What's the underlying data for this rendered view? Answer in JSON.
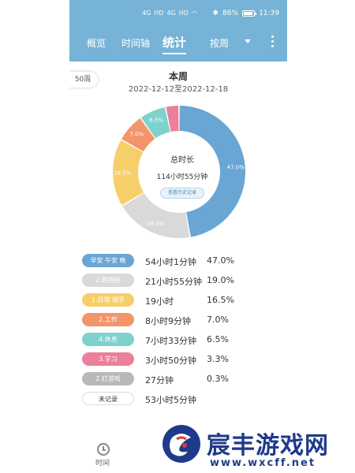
{
  "status_bar": {
    "left_glyphs": [
      "4G",
      "HD",
      "4G",
      "HD"
    ],
    "battery": "86%",
    "time": "11:39"
  },
  "nav": {
    "tabs": [
      {
        "label": "概览",
        "active": false
      },
      {
        "label": "时间轴",
        "active": false
      },
      {
        "label": "统计",
        "active": true
      }
    ],
    "period_select": "按周",
    "icons": [
      "chevron-down-icon",
      "more-vertical-icon"
    ],
    "bar_color": "#77b3d6"
  },
  "week": {
    "chip": "50周",
    "title": "本周",
    "range": "2022-12-12至2022-12-18"
  },
  "summary": {
    "total_label": "总时长",
    "total_value": "114小时55分钟",
    "history_button": "查看历史记录"
  },
  "chart_data": {
    "type": "pie",
    "variant": "donut",
    "slices": [
      {
        "label": "早安 午安 晚",
        "percent": 47.0,
        "color": "#6aa6d4"
      },
      {
        "label": "2.刷视频",
        "percent": 19.0,
        "color": "#d9d9d9"
      },
      {
        "label": "1.日常 顺手",
        "percent": 16.5,
        "color": "#f7cf6a"
      },
      {
        "label": "2.工作",
        "percent": 7.0,
        "color": "#f2956a"
      },
      {
        "label": "4.休息",
        "percent": 6.5,
        "color": "#7fd1cc"
      },
      {
        "label": "3.学习",
        "percent": 3.3,
        "color": "#ec7f9a"
      }
    ],
    "slice_labels": [
      "47.0%",
      "19.0%",
      "16.5%",
      "7.0%",
      "6.5%"
    ]
  },
  "legend": [
    {
      "label": "早安 午安 晚",
      "duration": "54小时1分钟",
      "percent": "47.0%",
      "color": "#6aa6d4"
    },
    {
      "label": "2.刷视频",
      "duration": "21小时55分钟",
      "percent": "19.0%",
      "color": "#d9d9d9"
    },
    {
      "label": "1.日常 顺手",
      "duration": "19小时",
      "percent": "16.5%",
      "color": "#f7cf6a"
    },
    {
      "label": "2.工作",
      "duration": "8小时9分钟",
      "percent": "7.0%",
      "color": "#f2956a"
    },
    {
      "label": "4.休息",
      "duration": "7小时33分钟",
      "percent": "6.5%",
      "color": "#7fd1cc"
    },
    {
      "label": "3.学习",
      "duration": "3小时50分钟",
      "percent": "3.3%",
      "color": "#ec7f9a"
    },
    {
      "label": "2.打游戏",
      "duration": "27分钟",
      "percent": "0.3%",
      "color": "#b8b8b8"
    },
    {
      "label": "未记录",
      "duration": "53小时5分钟",
      "percent": "",
      "color": "#ffffff"
    }
  ],
  "bottom_nav": {
    "label": "时间"
  },
  "watermark": {
    "text": "宸丰游戏网",
    "url": "www.wxcff.net"
  }
}
